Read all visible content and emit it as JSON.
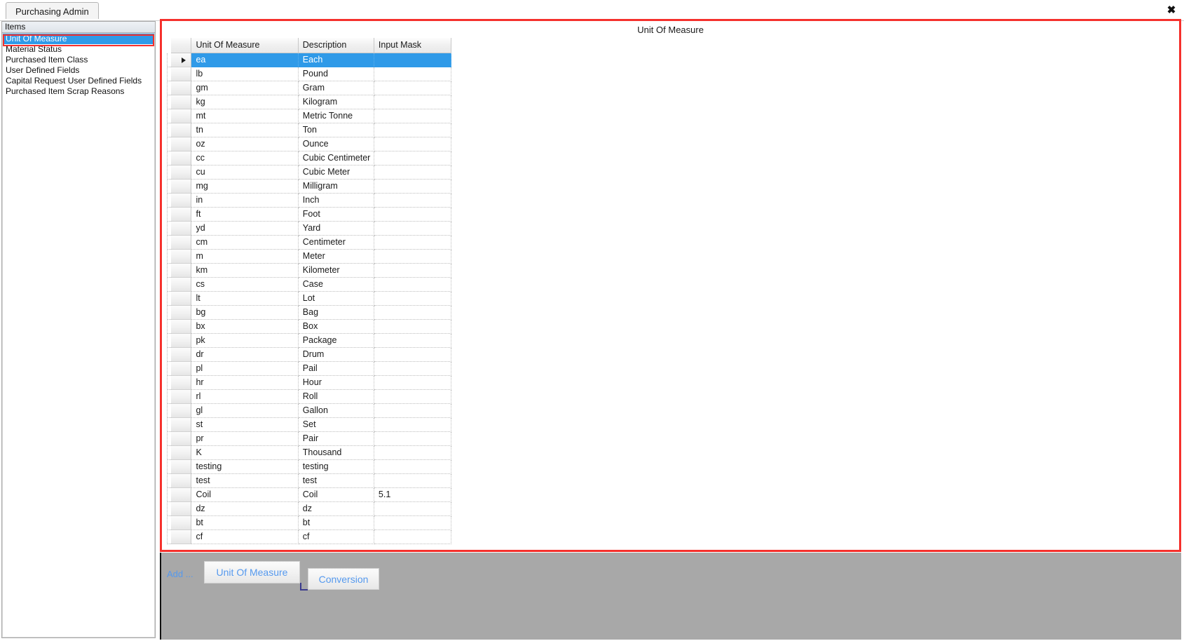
{
  "window": {
    "close_label": "✖"
  },
  "tabs": [
    {
      "label": "Purchasing Admin",
      "active": true
    }
  ],
  "sidebar": {
    "header": "Items",
    "items": [
      {
        "label": "Unit Of Measure",
        "selected": true
      },
      {
        "label": "Material Status",
        "selected": false
      },
      {
        "label": "Purchased Item Class",
        "selected": false
      },
      {
        "label": "User Defined Fields",
        "selected": false
      },
      {
        "label": "Capital Request User Defined Fields",
        "selected": false
      },
      {
        "label": "Purchased Item Scrap Reasons",
        "selected": false
      }
    ]
  },
  "content": {
    "title": "Unit Of Measure"
  },
  "grid": {
    "columns": [
      "Unit Of Measure",
      "Description",
      "Input Mask"
    ],
    "rows": [
      {
        "uom": "ea",
        "description": "Each",
        "input_mask": "",
        "selected": true
      },
      {
        "uom": "lb",
        "description": "Pound",
        "input_mask": "",
        "selected": false
      },
      {
        "uom": "gm",
        "description": "Gram",
        "input_mask": "",
        "selected": false
      },
      {
        "uom": "kg",
        "description": "Kilogram",
        "input_mask": "",
        "selected": false
      },
      {
        "uom": "mt",
        "description": "Metric Tonne",
        "input_mask": "",
        "selected": false
      },
      {
        "uom": "tn",
        "description": "Ton",
        "input_mask": "",
        "selected": false
      },
      {
        "uom": "oz",
        "description": "Ounce",
        "input_mask": "",
        "selected": false
      },
      {
        "uom": "cc",
        "description": "Cubic Centimeter",
        "input_mask": "",
        "selected": false
      },
      {
        "uom": "cu",
        "description": "Cubic Meter",
        "input_mask": "",
        "selected": false
      },
      {
        "uom": "mg",
        "description": "Milligram",
        "input_mask": "",
        "selected": false
      },
      {
        "uom": "in",
        "description": "Inch",
        "input_mask": "",
        "selected": false
      },
      {
        "uom": "ft",
        "description": "Foot",
        "input_mask": "",
        "selected": false
      },
      {
        "uom": "yd",
        "description": "Yard",
        "input_mask": "",
        "selected": false
      },
      {
        "uom": "cm",
        "description": "Centimeter",
        "input_mask": "",
        "selected": false
      },
      {
        "uom": "m",
        "description": "Meter",
        "input_mask": "",
        "selected": false
      },
      {
        "uom": "km",
        "description": "Kilometer",
        "input_mask": "",
        "selected": false
      },
      {
        "uom": "cs",
        "description": "Case",
        "input_mask": "",
        "selected": false
      },
      {
        "uom": "lt",
        "description": "Lot",
        "input_mask": "",
        "selected": false
      },
      {
        "uom": "bg",
        "description": "Bag",
        "input_mask": "",
        "selected": false
      },
      {
        "uom": "bx",
        "description": "Box",
        "input_mask": "",
        "selected": false
      },
      {
        "uom": "pk",
        "description": "Package",
        "input_mask": "",
        "selected": false
      },
      {
        "uom": "dr",
        "description": "Drum",
        "input_mask": "",
        "selected": false
      },
      {
        "uom": "pl",
        "description": "Pail",
        "input_mask": "",
        "selected": false
      },
      {
        "uom": "hr",
        "description": "Hour",
        "input_mask": "",
        "selected": false
      },
      {
        "uom": "rl",
        "description": "Roll",
        "input_mask": "",
        "selected": false
      },
      {
        "uom": "gl",
        "description": "Gallon",
        "input_mask": "",
        "selected": false
      },
      {
        "uom": "st",
        "description": "Set",
        "input_mask": "",
        "selected": false
      },
      {
        "uom": "pr",
        "description": "Pair",
        "input_mask": "",
        "selected": false
      },
      {
        "uom": "K",
        "description": "Thousand",
        "input_mask": "",
        "selected": false
      },
      {
        "uom": "testing",
        "description": "testing",
        "input_mask": "",
        "selected": false
      },
      {
        "uom": "test",
        "description": "test",
        "input_mask": "",
        "selected": false
      },
      {
        "uom": "Coil",
        "description": "Coil",
        "input_mask": "5.1",
        "selected": false
      },
      {
        "uom": "dz",
        "description": "dz",
        "input_mask": "",
        "selected": false
      },
      {
        "uom": "bt",
        "description": "bt",
        "input_mask": "",
        "selected": false
      },
      {
        "uom": "cf",
        "description": "cf",
        "input_mask": "",
        "selected": false
      }
    ]
  },
  "toolbar": {
    "add_label": "Add ...",
    "unit_of_measure_button": "Unit Of Measure",
    "conversion_button": "Conversion"
  },
  "colors": {
    "selection_blue": "#2f9ae8",
    "annotation_red": "#f5302c",
    "link_blue": "#5599ee",
    "toolbar_gray": "#a8a8a8"
  }
}
